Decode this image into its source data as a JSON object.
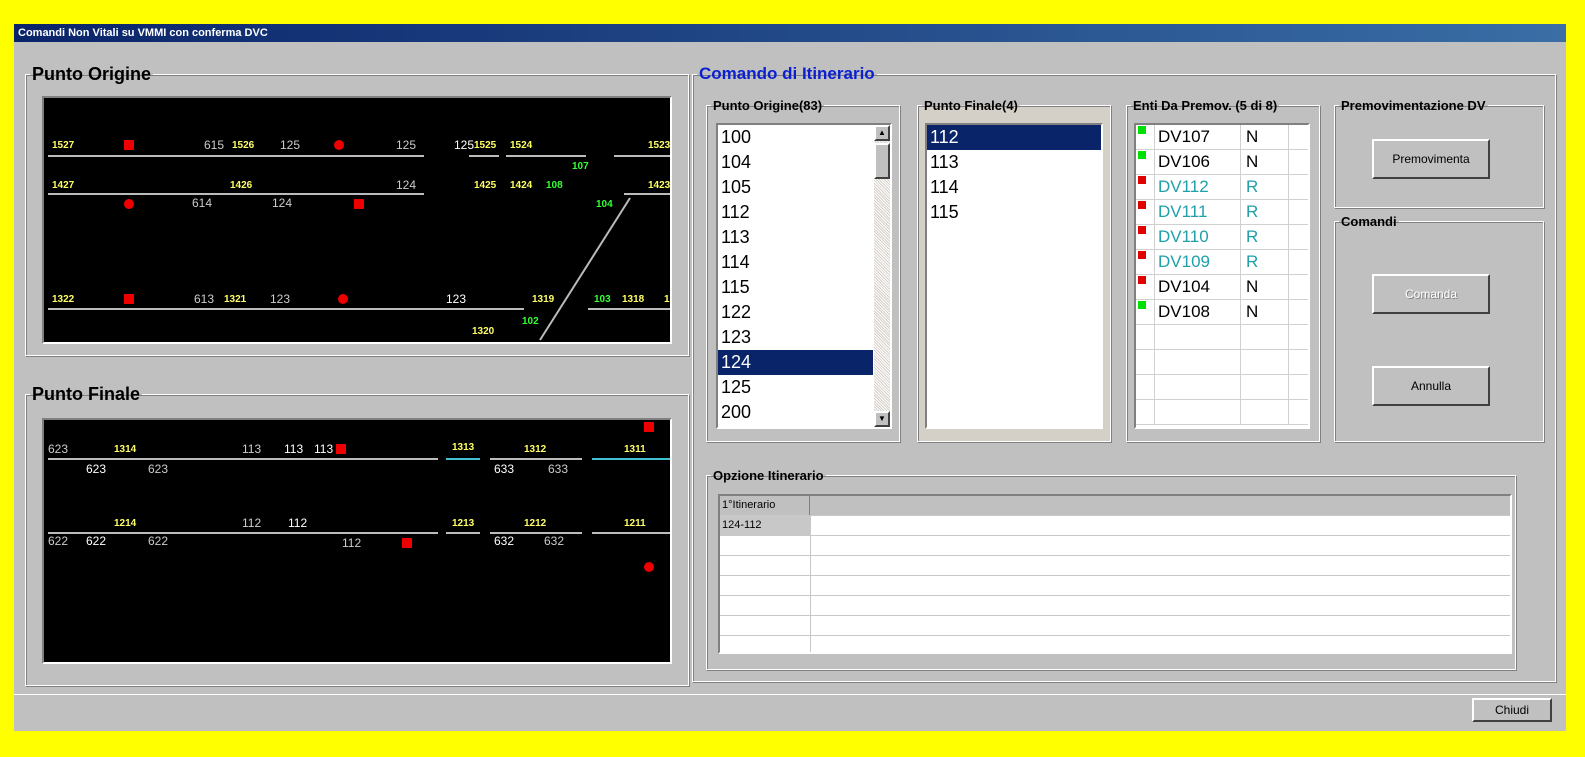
{
  "window": {
    "title": "Comandi Non Vitali su VMMI con conferma DVC"
  },
  "panels": {
    "origin_title": "Punto Origine",
    "final_title": "Punto Finale",
    "command_title": "Comando di Itinerario"
  },
  "schematic_origin": {
    "labels_y": [
      "1527",
      "1526",
      "1525",
      "1524",
      "1523",
      "1427",
      "1426",
      "1425",
      "1424",
      "1423",
      "1322",
      "1321",
      "1319",
      "1318",
      "1320",
      "1"
    ],
    "labels_w": [
      "615",
      "125",
      "125",
      "125",
      "614",
      "124",
      "124",
      "613",
      "123",
      "123"
    ],
    "labels_g": [
      "107",
      "108",
      "104",
      "103",
      "102"
    ]
  },
  "schematic_final": {
    "labels_y": [
      "1314",
      "1313",
      "1312",
      "1311",
      "1214",
      "1213",
      "1212",
      "1211"
    ],
    "labels_w": [
      "623",
      "623",
      "623",
      "113",
      "113",
      "113",
      "633",
      "633",
      "622",
      "622",
      "622",
      "112",
      "112",
      "112",
      "632",
      "632"
    ]
  },
  "origin_list": {
    "title": "Punto Origine(83)",
    "items": [
      "100",
      "104",
      "105",
      "112",
      "113",
      "114",
      "115",
      "122",
      "123",
      "124",
      "125",
      "200"
    ],
    "selected": "124"
  },
  "final_list": {
    "title": "Punto Finale(4)",
    "items": [
      "112",
      "113",
      "114",
      "115"
    ],
    "selected": "112"
  },
  "enti": {
    "title": "Enti Da Premov. (5 di 8)",
    "rows": [
      {
        "name": "DV107",
        "state": "N",
        "color": "#00e000",
        "text": "#000000"
      },
      {
        "name": "DV106",
        "state": "N",
        "color": "#00e000",
        "text": "#000000"
      },
      {
        "name": "DV112",
        "state": "R",
        "color": "#e00000",
        "text": "#20a0a8"
      },
      {
        "name": "DV111",
        "state": "R",
        "color": "#e00000",
        "text": "#20a0a8"
      },
      {
        "name": "DV110",
        "state": "R",
        "color": "#e00000",
        "text": "#20a0a8"
      },
      {
        "name": "DV109",
        "state": "R",
        "color": "#e00000",
        "text": "#20a0a8"
      },
      {
        "name": "DV104",
        "state": "N",
        "color": "#e00000",
        "text": "#000000"
      },
      {
        "name": "DV108",
        "state": "N",
        "color": "#00e000",
        "text": "#000000"
      }
    ]
  },
  "premov": {
    "title": "Premovimentazione DV",
    "button": "Premovimenta"
  },
  "comandi": {
    "title": "Comandi",
    "comanda": "Comanda",
    "annulla": "Annulla"
  },
  "opzione": {
    "title": "Opzione Itinerario",
    "header": "1°Itinerario",
    "value": "124-112"
  },
  "footer": {
    "close": "Chiudi"
  }
}
